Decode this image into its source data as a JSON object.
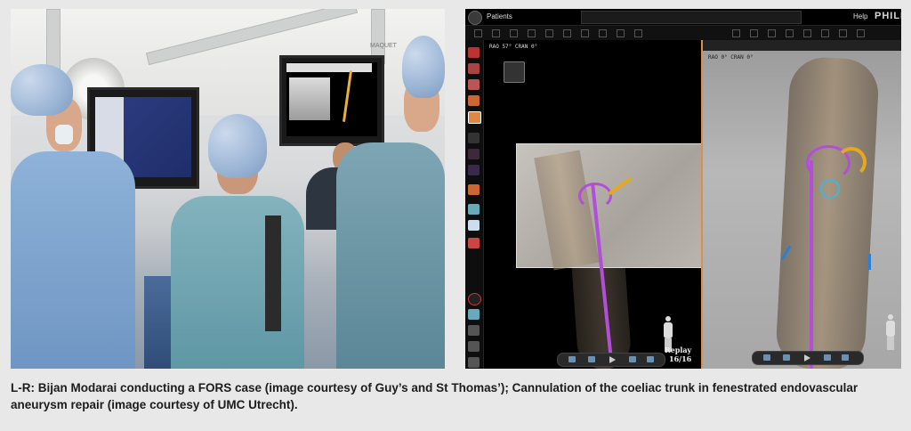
{
  "caption": "L-R: Bijan Modarai conducting a FORS case (image courtesy of Guy’s and St Thomas’); Cannulation of the coeliac trunk in fenestrated endovascular aneurysm repair (image courtesy of UMC Utrecht).",
  "photo_left": {
    "monitor_label": "MAQUET"
  },
  "screenshot_right": {
    "topbar": {
      "patients_label": "Patients",
      "help_label": "Help",
      "brand": "PHILIPS"
    },
    "left_view_angle": "RAO 57° CRAN 0°",
    "right_view_angle": "RAO 0° CRAN 0°",
    "replay_label": "Replay",
    "replay_counter": "16/16",
    "colors": {
      "catheter": "#b24fd8",
      "guidewire": "#e4a91f",
      "marker": "#43b5d8",
      "active_view_border": "#d8904a"
    }
  }
}
